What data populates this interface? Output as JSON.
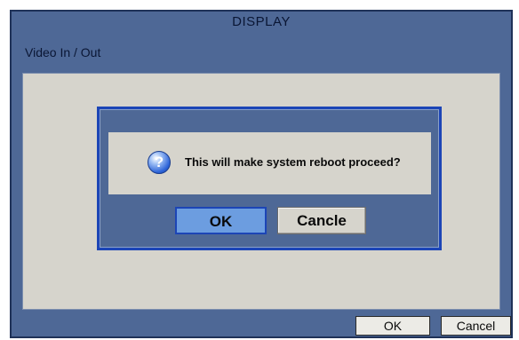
{
  "window": {
    "title": "DISPLAY",
    "section_label": "Video In / Out"
  },
  "dialog": {
    "icon": "question-icon",
    "icon_glyph": "?",
    "message": "This will make system reboot proceed?",
    "ok_label": "OK",
    "cancel_label": "Cancle"
  },
  "footer": {
    "ok_label": "OK",
    "cancel_label": "Cancel"
  },
  "colors": {
    "window_bg": "#4e6896",
    "panel_bg": "#d6d4cc",
    "dialog_border": "#1c45b6",
    "ok_highlight": "#6c9de0"
  }
}
